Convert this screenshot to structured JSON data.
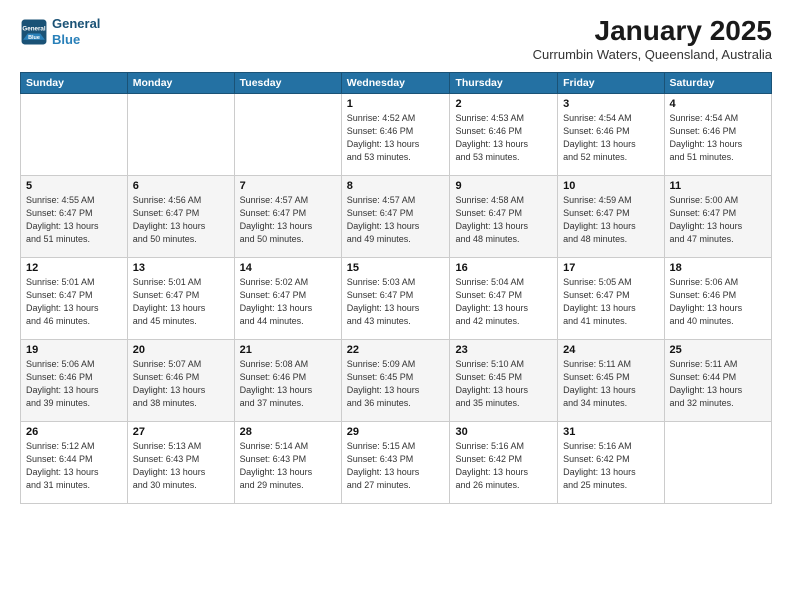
{
  "header": {
    "logo_line1": "General",
    "logo_line2": "Blue",
    "month": "January 2025",
    "location": "Currumbin Waters, Queensland, Australia"
  },
  "weekdays": [
    "Sunday",
    "Monday",
    "Tuesday",
    "Wednesday",
    "Thursday",
    "Friday",
    "Saturday"
  ],
  "weeks": [
    [
      {
        "day": "",
        "info": ""
      },
      {
        "day": "",
        "info": ""
      },
      {
        "day": "",
        "info": ""
      },
      {
        "day": "1",
        "info": "Sunrise: 4:52 AM\nSunset: 6:46 PM\nDaylight: 13 hours\nand 53 minutes."
      },
      {
        "day": "2",
        "info": "Sunrise: 4:53 AM\nSunset: 6:46 PM\nDaylight: 13 hours\nand 53 minutes."
      },
      {
        "day": "3",
        "info": "Sunrise: 4:54 AM\nSunset: 6:46 PM\nDaylight: 13 hours\nand 52 minutes."
      },
      {
        "day": "4",
        "info": "Sunrise: 4:54 AM\nSunset: 6:46 PM\nDaylight: 13 hours\nand 51 minutes."
      }
    ],
    [
      {
        "day": "5",
        "info": "Sunrise: 4:55 AM\nSunset: 6:47 PM\nDaylight: 13 hours\nand 51 minutes."
      },
      {
        "day": "6",
        "info": "Sunrise: 4:56 AM\nSunset: 6:47 PM\nDaylight: 13 hours\nand 50 minutes."
      },
      {
        "day": "7",
        "info": "Sunrise: 4:57 AM\nSunset: 6:47 PM\nDaylight: 13 hours\nand 50 minutes."
      },
      {
        "day": "8",
        "info": "Sunrise: 4:57 AM\nSunset: 6:47 PM\nDaylight: 13 hours\nand 49 minutes."
      },
      {
        "day": "9",
        "info": "Sunrise: 4:58 AM\nSunset: 6:47 PM\nDaylight: 13 hours\nand 48 minutes."
      },
      {
        "day": "10",
        "info": "Sunrise: 4:59 AM\nSunset: 6:47 PM\nDaylight: 13 hours\nand 48 minutes."
      },
      {
        "day": "11",
        "info": "Sunrise: 5:00 AM\nSunset: 6:47 PM\nDaylight: 13 hours\nand 47 minutes."
      }
    ],
    [
      {
        "day": "12",
        "info": "Sunrise: 5:01 AM\nSunset: 6:47 PM\nDaylight: 13 hours\nand 46 minutes."
      },
      {
        "day": "13",
        "info": "Sunrise: 5:01 AM\nSunset: 6:47 PM\nDaylight: 13 hours\nand 45 minutes."
      },
      {
        "day": "14",
        "info": "Sunrise: 5:02 AM\nSunset: 6:47 PM\nDaylight: 13 hours\nand 44 minutes."
      },
      {
        "day": "15",
        "info": "Sunrise: 5:03 AM\nSunset: 6:47 PM\nDaylight: 13 hours\nand 43 minutes."
      },
      {
        "day": "16",
        "info": "Sunrise: 5:04 AM\nSunset: 6:47 PM\nDaylight: 13 hours\nand 42 minutes."
      },
      {
        "day": "17",
        "info": "Sunrise: 5:05 AM\nSunset: 6:47 PM\nDaylight: 13 hours\nand 41 minutes."
      },
      {
        "day": "18",
        "info": "Sunrise: 5:06 AM\nSunset: 6:46 PM\nDaylight: 13 hours\nand 40 minutes."
      }
    ],
    [
      {
        "day": "19",
        "info": "Sunrise: 5:06 AM\nSunset: 6:46 PM\nDaylight: 13 hours\nand 39 minutes."
      },
      {
        "day": "20",
        "info": "Sunrise: 5:07 AM\nSunset: 6:46 PM\nDaylight: 13 hours\nand 38 minutes."
      },
      {
        "day": "21",
        "info": "Sunrise: 5:08 AM\nSunset: 6:46 PM\nDaylight: 13 hours\nand 37 minutes."
      },
      {
        "day": "22",
        "info": "Sunrise: 5:09 AM\nSunset: 6:45 PM\nDaylight: 13 hours\nand 36 minutes."
      },
      {
        "day": "23",
        "info": "Sunrise: 5:10 AM\nSunset: 6:45 PM\nDaylight: 13 hours\nand 35 minutes."
      },
      {
        "day": "24",
        "info": "Sunrise: 5:11 AM\nSunset: 6:45 PM\nDaylight: 13 hours\nand 34 minutes."
      },
      {
        "day": "25",
        "info": "Sunrise: 5:11 AM\nSunset: 6:44 PM\nDaylight: 13 hours\nand 32 minutes."
      }
    ],
    [
      {
        "day": "26",
        "info": "Sunrise: 5:12 AM\nSunset: 6:44 PM\nDaylight: 13 hours\nand 31 minutes."
      },
      {
        "day": "27",
        "info": "Sunrise: 5:13 AM\nSunset: 6:43 PM\nDaylight: 13 hours\nand 30 minutes."
      },
      {
        "day": "28",
        "info": "Sunrise: 5:14 AM\nSunset: 6:43 PM\nDaylight: 13 hours\nand 29 minutes."
      },
      {
        "day": "29",
        "info": "Sunrise: 5:15 AM\nSunset: 6:43 PM\nDaylight: 13 hours\nand 27 minutes."
      },
      {
        "day": "30",
        "info": "Sunrise: 5:16 AM\nSunset: 6:42 PM\nDaylight: 13 hours\nand 26 minutes."
      },
      {
        "day": "31",
        "info": "Sunrise: 5:16 AM\nSunset: 6:42 PM\nDaylight: 13 hours\nand 25 minutes."
      },
      {
        "day": "",
        "info": ""
      }
    ]
  ]
}
